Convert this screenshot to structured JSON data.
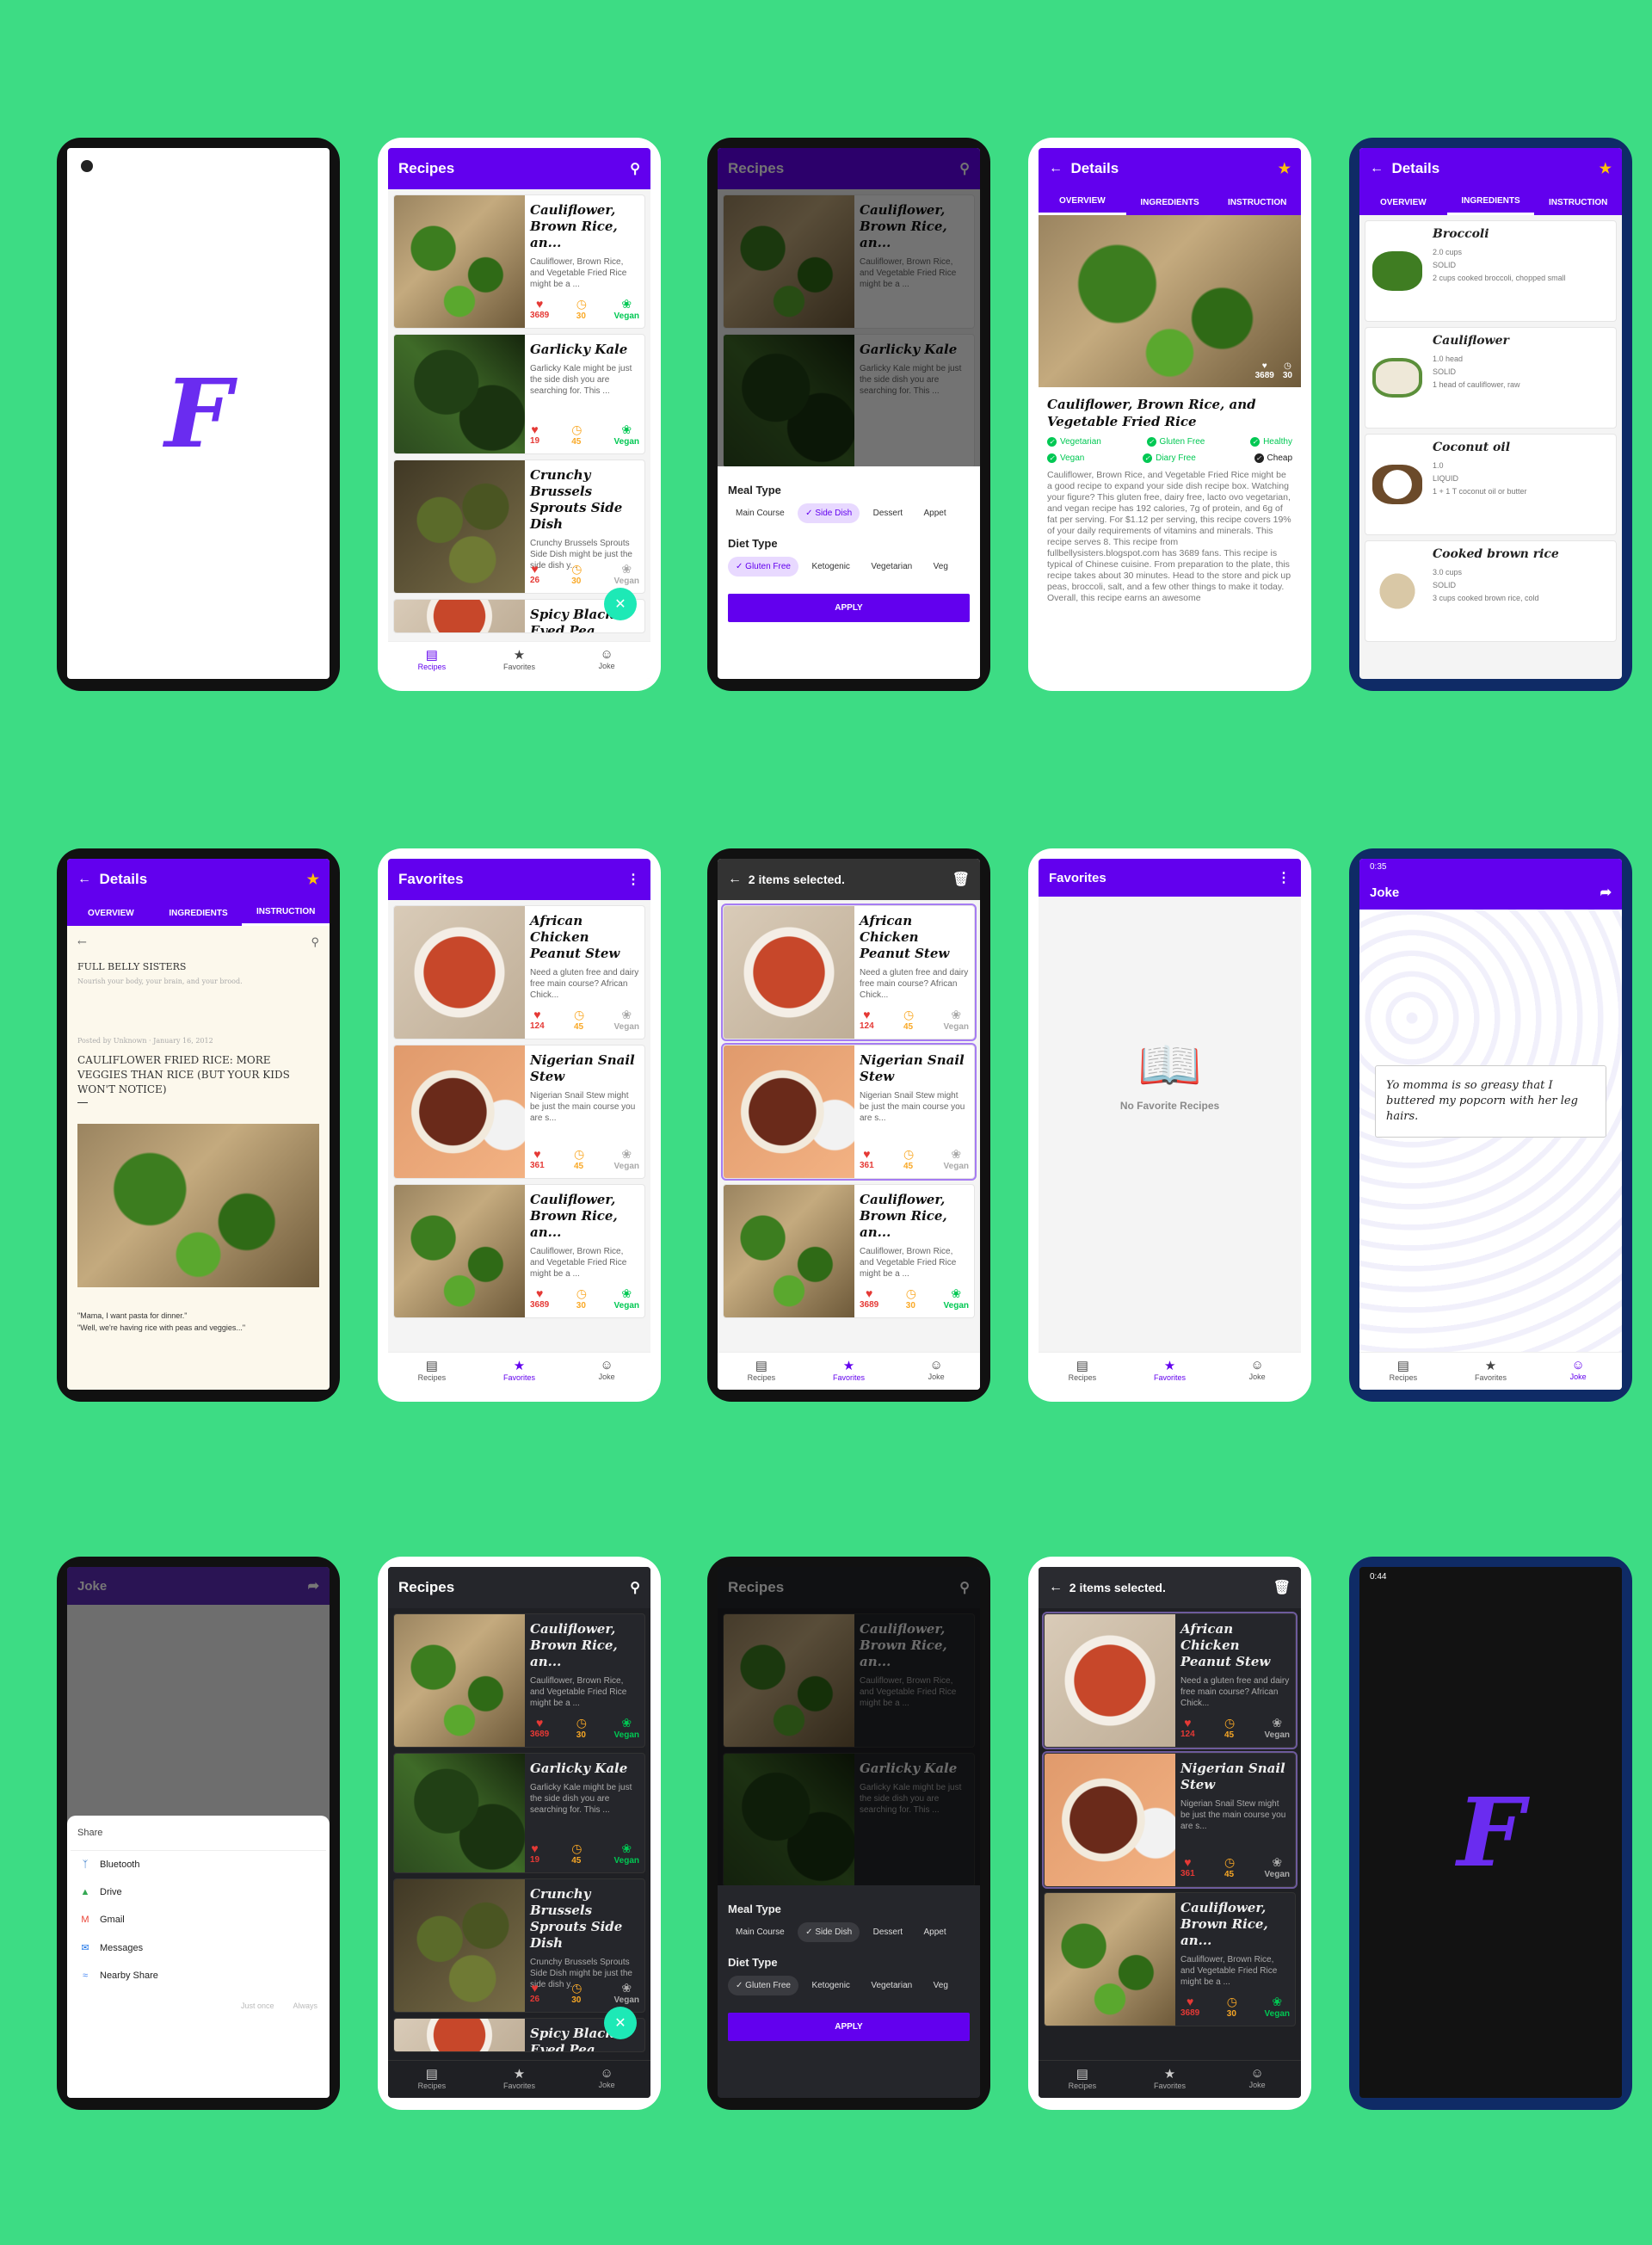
{
  "splash": {
    "logo_letter": "F"
  },
  "recipes_screen": {
    "title": "Recipes",
    "search_icon": "search-icon",
    "recipes": [
      {
        "title": "Cauliflower, Brown Rice, an...",
        "description": "Cauliflower, Brown Rice, and Vegetable Fried Rice might be a ...",
        "likes": "3689",
        "minutes": "30",
        "vegan_label": "Vegan"
      },
      {
        "title": "Garlicky Kale",
        "description": "Garlicky Kale might be just the side dish you are searching for. This ...",
        "likes": "19",
        "minutes": "45",
        "vegan_label": "Vegan"
      },
      {
        "title": "Crunchy Brussels Sprouts Side Dish",
        "description": "Crunchy Brussels Sprouts Side Dish might be just the side dish y...",
        "likes": "26",
        "minutes": "30",
        "vegan_label": "Vegan"
      },
      {
        "title": "Spicy Black-Eyed Pea Curry with",
        "description": "",
        "likes": "",
        "minutes": "",
        "vegan_label": ""
      }
    ]
  },
  "nav": {
    "recipes": "Recipes",
    "favorites": "Favorites",
    "joke": "Joke"
  },
  "filter_sheet": {
    "meal_type_title": "Meal Type",
    "meal_types": [
      "Main Course",
      "Side Dish",
      "Dessert",
      "Appet"
    ],
    "meal_selected": "Side Dish",
    "diet_type_title": "Diet Type",
    "diet_types": [
      "Gluten Free",
      "Ketogenic",
      "Vegetarian",
      "Veg"
    ],
    "diet_selected": "Gluten Free",
    "apply_label": "APPLY"
  },
  "details": {
    "title": "Details",
    "tabs": [
      "OVERVIEW",
      "INGREDIENTS",
      "INSTRUCTION"
    ],
    "recipe_title": "Cauliflower, Brown Rice, and Vegetable Fried Rice",
    "likes": "3689",
    "minutes": "30",
    "tags": [
      [
        "Vegetarian",
        "Gluten Free",
        "Healthy"
      ],
      [
        "Vegan",
        "Diary Free",
        "Cheap"
      ]
    ],
    "summary": "Cauliflower, Brown Rice, and Vegetable Fried Rice might be a good recipe to expand your side dish recipe box. Watching your figure? This gluten free, dairy free, lacto ovo vegetarian, and vegan recipe has 192 calories, 7g of protein, and 6g of fat per serving. For $1.12 per serving, this recipe covers 19% of your daily requirements of vitamins and minerals. This recipe serves 8. This recipe from fullbellysisters.blogspot.com has 3689 fans. This recipe is typical of Chinese cuisine. From preparation to the plate, this recipe takes about 30 minutes. Head to the store and pick up peas, broccoli, salt, and a few other things to make it today. Overall, this recipe earns an awesome"
  },
  "ingredients": [
    {
      "name": "Broccoli",
      "amount": "2.0",
      "unit": "cups",
      "consistency": "SOLID",
      "original": "2 cups cooked broccoli, chopped small"
    },
    {
      "name": "Cauliflower",
      "amount": "1.0",
      "unit": "head",
      "consistency": "SOLID",
      "original": "1 head of cauliflower, raw"
    },
    {
      "name": "Coconut oil",
      "amount": "1.0",
      "unit": "",
      "consistency": "LIQUID",
      "original": "1 + 1 T coconut oil or butter"
    },
    {
      "name": "Cooked brown rice",
      "amount": "3.0",
      "unit": "cups",
      "consistency": "SOLID",
      "original": "3 cups cooked brown rice, cold"
    }
  ],
  "instruction": {
    "blog_name": "FULL BELLY SISTERS",
    "blog_tagline": "Nourish your body, your brain, and your brood.",
    "posted": "Posted by Unknown · January 16, 2012",
    "post_title": "CAULIFLOWER FRIED RICE: MORE VEGGIES THAN RICE (BUT YOUR KIDS WON'T NOTICE)",
    "quote1": "\"Mama, I want pasta for dinner.\"",
    "quote2": "\"Well, we're having rice with peas and veggies...\""
  },
  "favorites": {
    "title": "Favorites",
    "items": [
      {
        "title": "African Chicken Peanut Stew",
        "description": "Need a gluten free and dairy free main course? African Chick...",
        "likes": "124",
        "minutes": "45",
        "vegan_label": "Vegan"
      },
      {
        "title": "Nigerian Snail Stew",
        "description": "Nigerian Snail Stew might be just the main course you are s...",
        "likes": "361",
        "minutes": "45",
        "vegan_label": "Vegan"
      },
      {
        "title": "Cauliflower, Brown Rice, an...",
        "description": "Cauliflower, Brown Rice, and Vegetable Fried Rice might be a ...",
        "likes": "3689",
        "minutes": "30",
        "vegan_label": "Vegan"
      }
    ],
    "selected_text": "2 items selected.",
    "empty_text": "No Favorite Recipes"
  },
  "joke": {
    "title": "Joke",
    "status_time": "0:35",
    "text": "Yo momma is so greasy that I buttered my popcorn with her leg hairs."
  },
  "share": {
    "title": "Share",
    "options": [
      "Bluetooth",
      "Drive",
      "Gmail",
      "Messages",
      "Nearby Share"
    ],
    "just_once": "Just once",
    "always": "Always"
  },
  "status_time_last": "0:44",
  "colors": {
    "primary": "#6200ee",
    "background": "#3ddc84",
    "like": "#e53935",
    "time": "#f9a825",
    "vegan": "#00c853"
  }
}
